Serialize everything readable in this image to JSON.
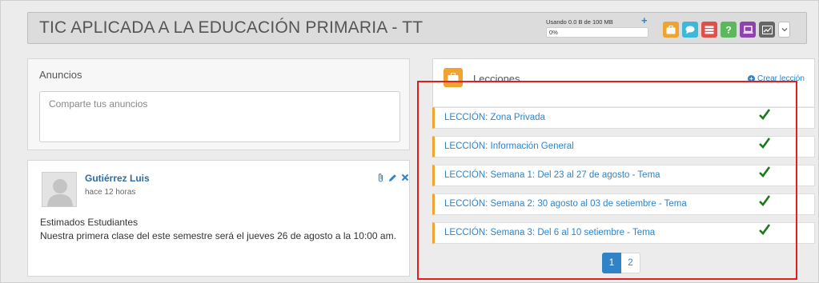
{
  "course": {
    "title": "TIC APLICADA A LA EDUCACIÓN PRIMARIA - TT"
  },
  "storage": {
    "label": "Usando 0.0 B de 100 MB",
    "percent_label": "0%",
    "add_symbol": "+"
  },
  "toolbar": {
    "buttons": [
      {
        "icon": "briefcase-icon",
        "color": "#f0a330"
      },
      {
        "icon": "chat-icon",
        "color": "#3db8d8"
      },
      {
        "icon": "stack-icon",
        "color": "#e0504a"
      },
      {
        "icon": "question-icon",
        "color": "#5cb85c"
      },
      {
        "icon": "laptop-icon",
        "color": "#8e44ad"
      },
      {
        "icon": "chart-icon",
        "color": "#666666"
      }
    ]
  },
  "announcements": {
    "title": "Anuncios",
    "placeholder": "Comparte tus anuncios"
  },
  "post": {
    "author": "Gutiérrez Luis",
    "time": "hace 12 horas",
    "line1": "Estimados Estudiantes",
    "line2": "Nuestra primera clase del este semestre será el jueves 26 de agosto a la 10:00 am."
  },
  "lessons": {
    "title": "Lecciones",
    "create_label": "Crear lección",
    "items": [
      {
        "label": "LECCIÓN: Zona Privada"
      },
      {
        "label": "LECCIÓN: Información General"
      },
      {
        "label": "LECCIÓN: Semana 1: Del 23 al 27 de agosto - Tema"
      },
      {
        "label": "LECCIÓN: Semana 2: 30 agosto al 03 de setiembre - Tema"
      },
      {
        "label": "LECCIÓN: Semana 3: Del 6 al 10 setiembre - Tema"
      }
    ],
    "pages": [
      "1",
      "2"
    ],
    "active_page": "1"
  },
  "colors": {
    "accent": "#2f83c6",
    "lesson_bar": "#f0a330",
    "check": "#1a7a1a",
    "highlight": "#e02020"
  }
}
